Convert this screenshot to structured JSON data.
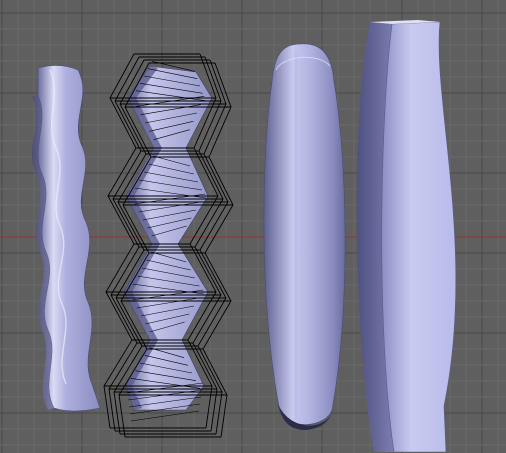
{
  "viewport": {
    "label": "",
    "background": "#5f5f5f",
    "grid_minor_color": "#6a6a6a",
    "grid_major_color": "#4a4a4a",
    "x_axis_color": "#9a3030",
    "object_color_light": "#c8cae8",
    "object_color_mid": "#9a9ccc",
    "object_color_dark": "#5a5c88",
    "wireframe_color": "#000000"
  },
  "objects": [
    {
      "name": "wavy-strip-smooth",
      "icon": "curved-mesh"
    },
    {
      "name": "zigzag-strip-lattice",
      "icon": "lattice-deformed-mesh"
    },
    {
      "name": "barrel-rounded",
      "icon": "bulged-capsule-mesh"
    },
    {
      "name": "slab-bent",
      "icon": "bent-box-mesh"
    }
  ]
}
